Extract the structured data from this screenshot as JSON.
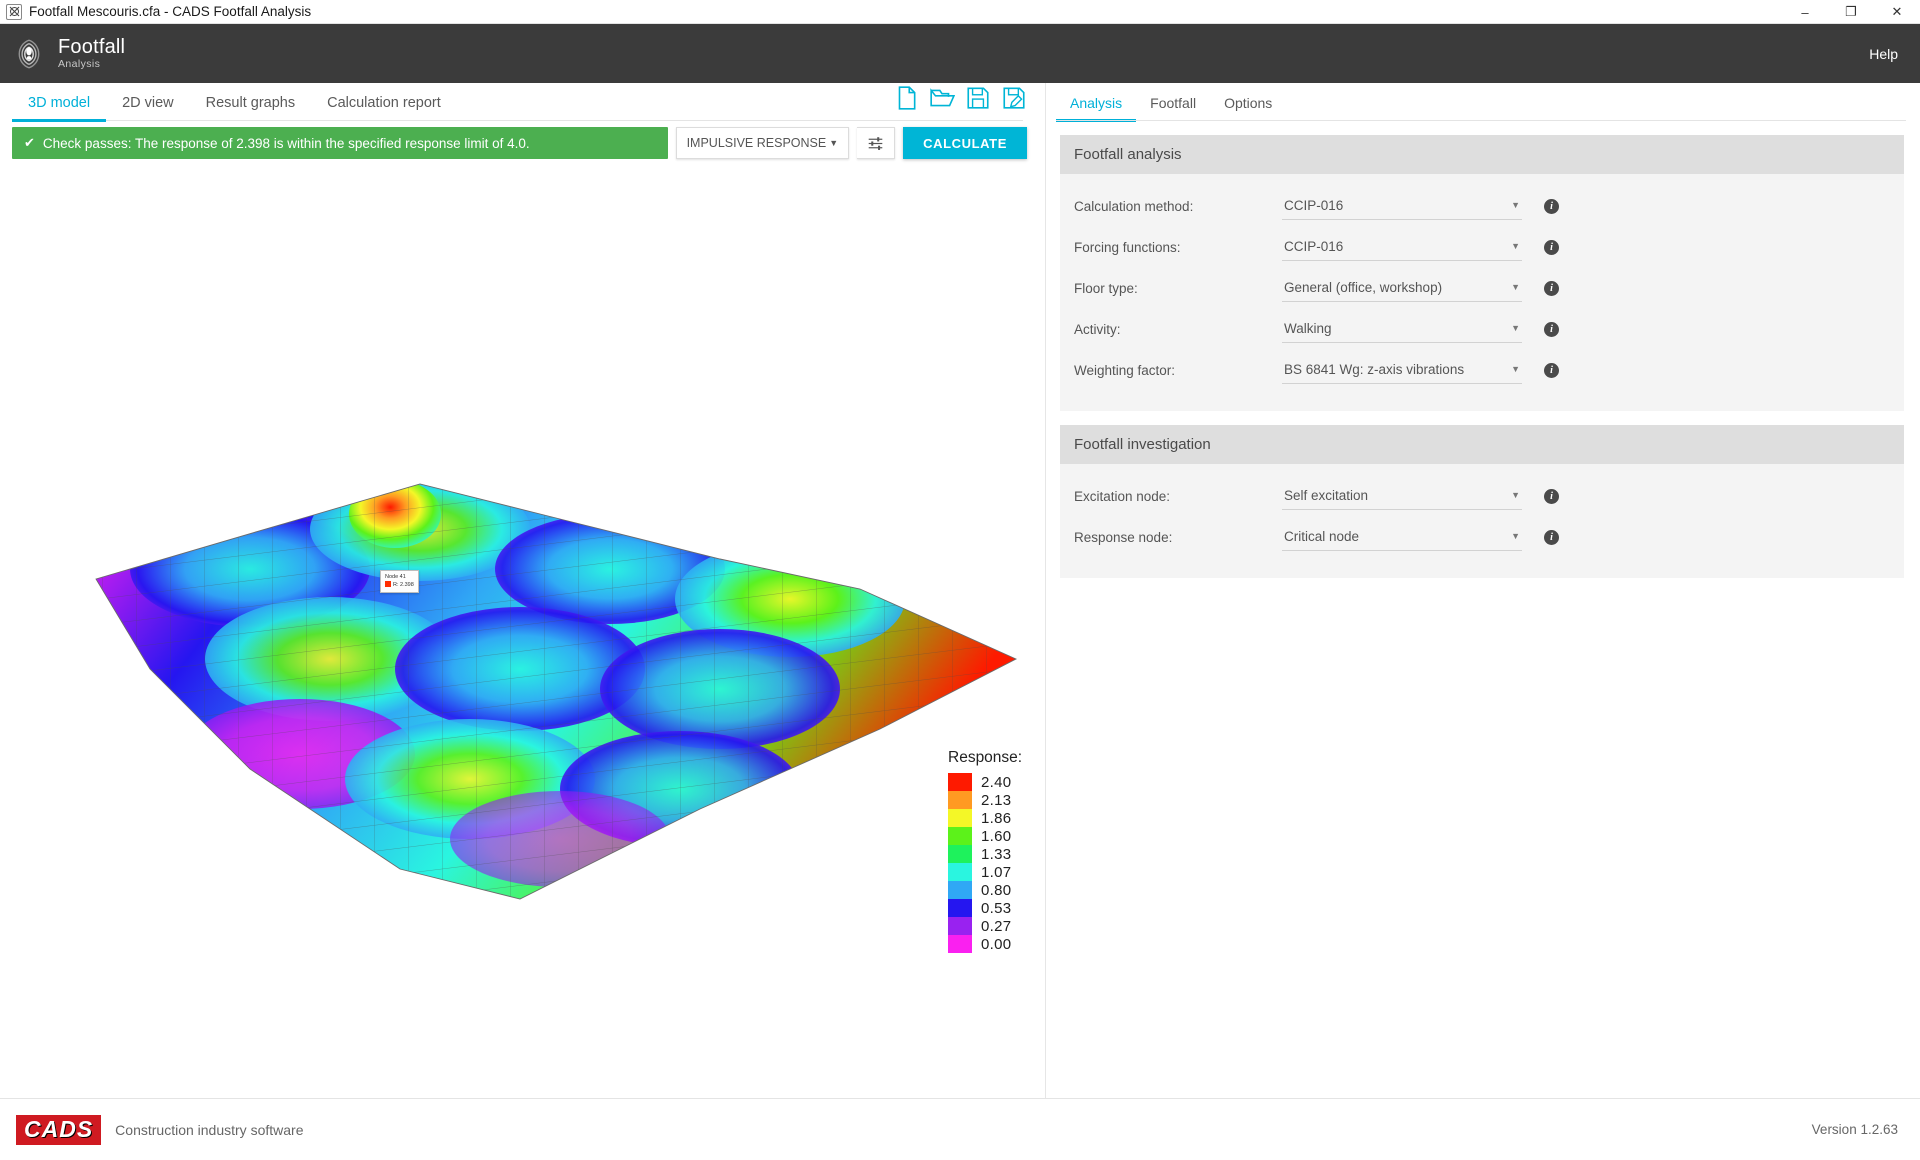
{
  "window": {
    "title": "Footfall Mescouris.cfa - CADS Footfall Analysis",
    "app_icon": "app-icon",
    "minimize": "–",
    "maximize": "❐",
    "close": "✕"
  },
  "header": {
    "logo_title": "Footfall",
    "logo_sub": "Analysis",
    "help": "Help"
  },
  "left": {
    "tabs": [
      {
        "label": "3D model",
        "active": true
      },
      {
        "label": "2D view",
        "active": false
      },
      {
        "label": "Result graphs",
        "active": false
      },
      {
        "label": "Calculation report",
        "active": false
      }
    ],
    "file_icons": [
      "new-file-icon",
      "open-folder-icon",
      "save-icon",
      "save-as-icon"
    ],
    "status": {
      "check_glyph": "✔",
      "message": "Check passes: The response of 2.398 is within the specified response limit of 4.0."
    },
    "response_select": {
      "value": "IMPULSIVE RESPONSE",
      "caret": "▼"
    },
    "settings_button": "settings-sliders-icon",
    "calculate_button": "CALCULATE",
    "node_tooltip": {
      "name": "Node 41",
      "value": "R: 2.398"
    }
  },
  "chart_data": {
    "type": "heatmap",
    "title": "Response:",
    "colorbar_label": "Response:",
    "legend_entries": [
      {
        "value": "2.40",
        "color": "#fe1a00"
      },
      {
        "value": "2.13",
        "color": "#ff9a22"
      },
      {
        "value": "1.86",
        "color": "#f4f727"
      },
      {
        "value": "1.60",
        "color": "#5cf21a"
      },
      {
        "value": "1.33",
        "color": "#1ef25c"
      },
      {
        "value": "1.07",
        "color": "#2af5e0"
      },
      {
        "value": "0.80",
        "color": "#30a8f5"
      },
      {
        "value": "0.53",
        "color": "#2516f0"
      },
      {
        "value": "0.27",
        "color": "#9922f0"
      },
      {
        "value": "0.00",
        "color": "#fa20f0"
      }
    ],
    "values": [
      2.4,
      2.13,
      1.86,
      1.6,
      1.33,
      1.07,
      0.8,
      0.53,
      0.27,
      0.0
    ],
    "zrange": [
      0.0,
      2.4
    ],
    "peak_response": 2.398,
    "response_limit": 4.0
  },
  "right": {
    "tabs": [
      {
        "label": "Analysis",
        "active": true
      },
      {
        "label": "Footfall",
        "active": false
      },
      {
        "label": "Options",
        "active": false
      }
    ],
    "analysis": {
      "header": "Footfall analysis",
      "fields": [
        {
          "label": "Calculation method:",
          "value": "CCIP-016"
        },
        {
          "label": "Forcing functions:",
          "value": "CCIP-016"
        },
        {
          "label": "Floor type:",
          "value": "General (office, workshop)"
        },
        {
          "label": "Activity:",
          "value": "Walking"
        },
        {
          "label": "Weighting factor:",
          "value": "BS 6841 Wg: z-axis vibrations"
        }
      ]
    },
    "investigation": {
      "header": "Footfall investigation",
      "fields": [
        {
          "label": "Excitation node:",
          "value": "Self excitation"
        },
        {
          "label": "Response node:",
          "value": "Critical node"
        }
      ]
    },
    "caret": "▼",
    "info_glyph": "i"
  },
  "footer": {
    "logo": "CADS",
    "tagline": "Construction industry software",
    "version": "Version 1.2.63"
  }
}
